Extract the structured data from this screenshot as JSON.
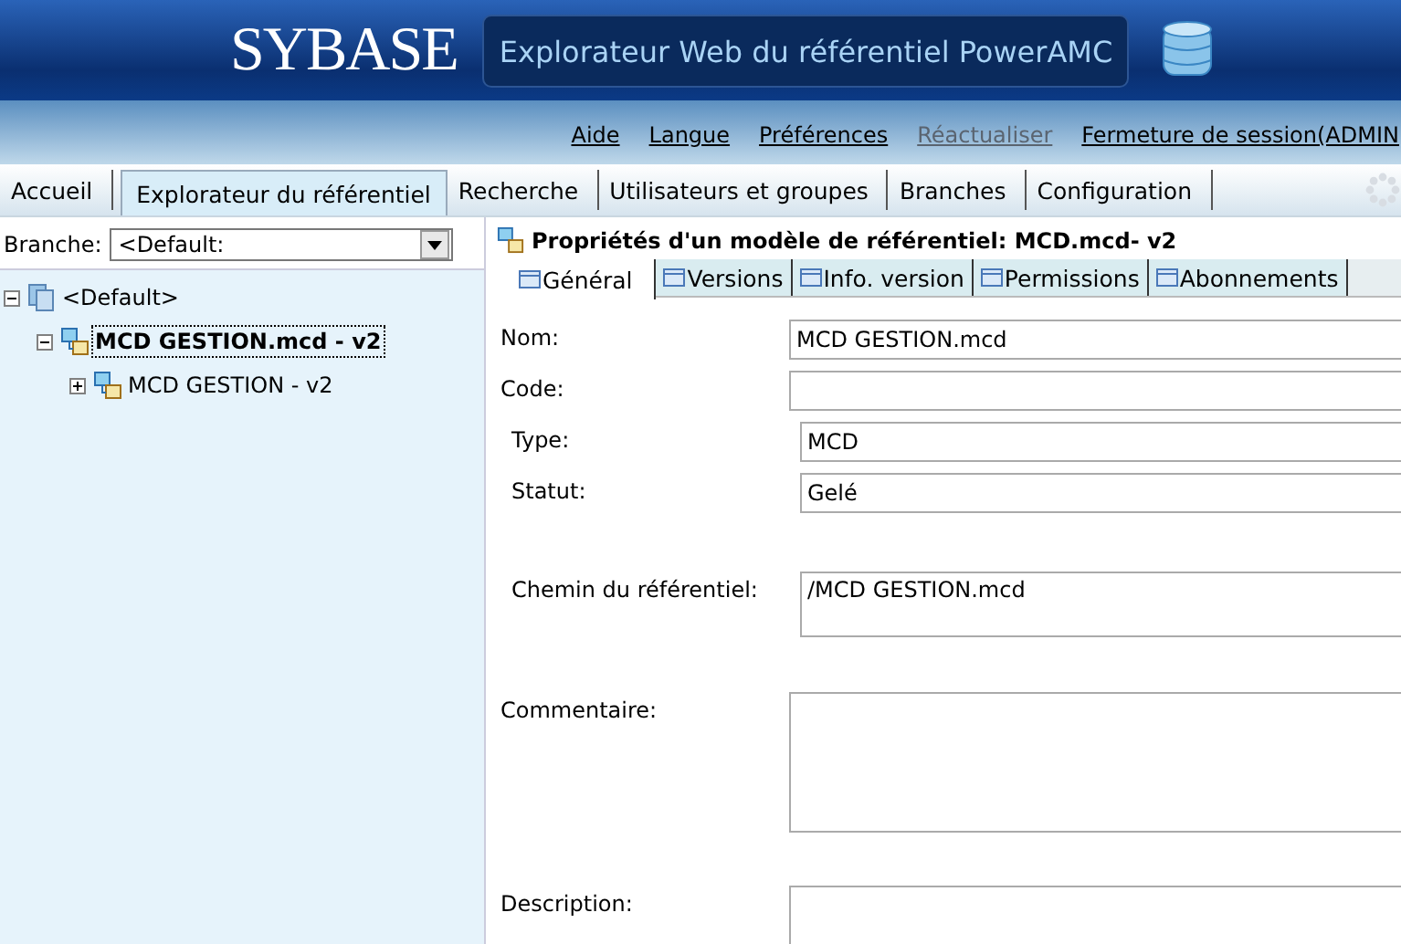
{
  "header": {
    "logo": "SYBASE",
    "title": "Explorateur Web du référentiel PowerAMC"
  },
  "links": [
    {
      "label": "Aide",
      "disabled": false
    },
    {
      "label": "Langue",
      "disabled": false
    },
    {
      "label": "Préférences",
      "disabled": false
    },
    {
      "label": "Réactualiser",
      "disabled": true
    },
    {
      "label": "Fermeture de session(ADMIN",
      "disabled": false
    }
  ],
  "tabs": [
    {
      "label": "Accueil",
      "selected": false
    },
    {
      "label": "Explorateur du référentiel",
      "selected": true
    },
    {
      "label": "Recherche",
      "selected": false
    },
    {
      "label": "Utilisateurs et groupes",
      "selected": false
    },
    {
      "label": "Branches",
      "selected": false
    },
    {
      "label": "Configuration",
      "selected": false
    }
  ],
  "branch": {
    "label": "Branche:",
    "value": "<Default:"
  },
  "tree": [
    {
      "label": "<Default>",
      "kind": "repository",
      "expanded": true,
      "selected": false,
      "children": [
        {
          "label": "MCD GESTION.mcd - v2",
          "kind": "model",
          "expanded": true,
          "selected": true,
          "children": [
            {
              "label": "MCD GESTION - v2",
              "kind": "model",
              "expanded": false,
              "selected": false
            }
          ]
        }
      ]
    }
  ],
  "properties": {
    "title": "Propriétés d'un modèle de référentiel: MCD.mcd- v2",
    "tabs": [
      {
        "label": "Général",
        "selected": true
      },
      {
        "label": "Versions",
        "selected": false
      },
      {
        "label": "Info. version",
        "selected": false
      },
      {
        "label": "Permissions",
        "selected": false
      },
      {
        "label": "Abonnements",
        "selected": false
      }
    ],
    "fields": [
      {
        "label": "Nom:",
        "value": "MCD GESTION.mcd",
        "kind": "line"
      },
      {
        "label": "Code:",
        "kind": "line"
      },
      {
        "label": "Type:",
        "value": "MCD",
        "kind": "line"
      },
      {
        "label": "Statut:",
        "value": "Gelé",
        "kind": "line"
      },
      {
        "label": "Chemin du référentiel:",
        "value": "/MCD GESTION.mcd",
        "kind": "path"
      },
      {
        "label": "Commentaire:",
        "kind": "area"
      },
      {
        "label": "Description:",
        "kind": "area"
      }
    ]
  }
}
